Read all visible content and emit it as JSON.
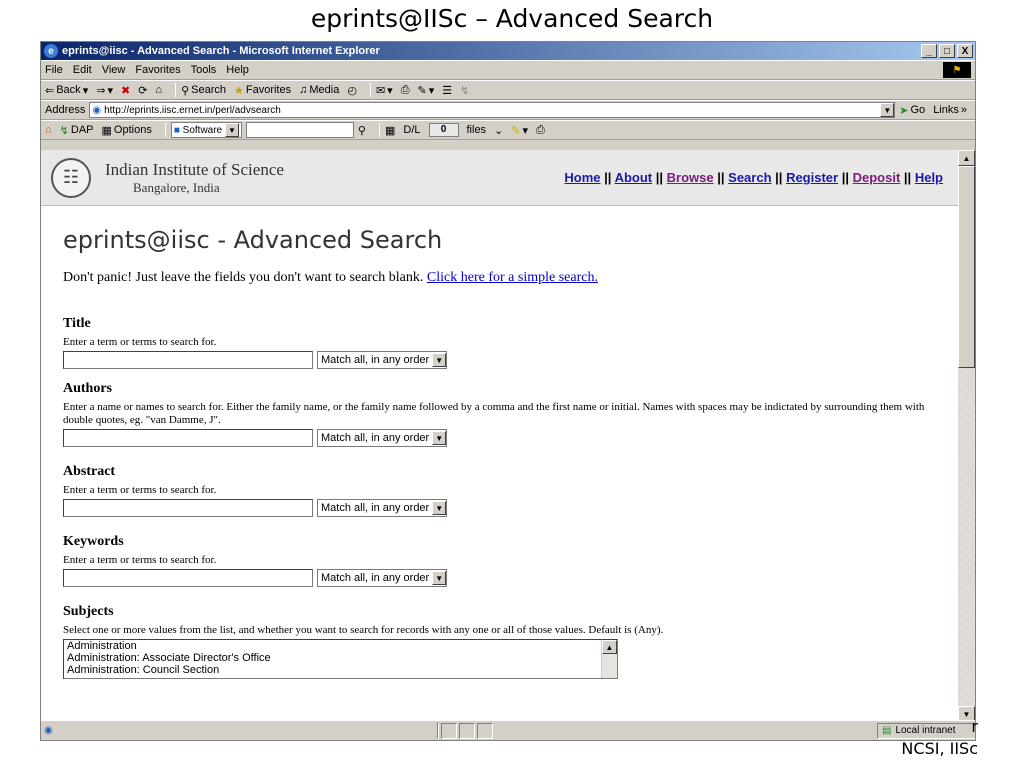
{
  "slide": {
    "title": "eprints@IISc – Advanced Search",
    "footer_lines": [
      "r",
      "NCSI, IISc"
    ]
  },
  "window": {
    "title": "eprints@iisc - Advanced Search - Microsoft Internet Explorer",
    "controls": [
      "_",
      "□",
      "X"
    ]
  },
  "menubar": {
    "items": [
      "File",
      "Edit",
      "View",
      "Favorites",
      "Tools",
      "Help"
    ]
  },
  "toolbar": {
    "back": "Back",
    "search": "Search",
    "favorites": "Favorites",
    "media": "Media"
  },
  "addressbar": {
    "label": "Address",
    "url": "http://eprints.iisc.ernet.in/perl/advsearch",
    "go": "Go",
    "links": "Links"
  },
  "extrabar": {
    "dap": "DAP",
    "options": "Options",
    "software": "Software",
    "dl": "D/L",
    "count": "0",
    "files": "files"
  },
  "site": {
    "institute": "Indian Institute of Science",
    "location": "Bangalore, India",
    "nav": [
      {
        "label": "Home"
      },
      {
        "label": "About"
      },
      {
        "label": "Browse"
      },
      {
        "label": "Search"
      },
      {
        "label": "Register"
      },
      {
        "label": "Deposit"
      },
      {
        "label": "Help"
      }
    ],
    "nav_sep": "||"
  },
  "page": {
    "heading": "eprints@iisc - Advanced Search",
    "intro": "Don't panic! Just leave the fields you don't want to search blank.",
    "simple_link": "Click here for a simple search.",
    "match_default": "Match all, in any order",
    "sections": {
      "title": {
        "heading": "Title",
        "desc": "Enter a term or terms to search for."
      },
      "authors": {
        "heading": "Authors",
        "desc": "Enter a name or names to search for. Either the family name, or the family name followed by a comma and the first name or initial. Names with spaces may be indictated by surrounding them with double quotes, eg. \"van Damme, J\"."
      },
      "abstract": {
        "heading": "Abstract",
        "desc": "Enter a term or terms to search for."
      },
      "keywords": {
        "heading": "Keywords",
        "desc": "Enter a term or terms to search for."
      },
      "subjects": {
        "heading": "Subjects",
        "desc": "Select one or more values from the list, and whether you want to search for records with any one or all of those values. Default is (Any).",
        "options": [
          "Administration",
          "Administration: Associate Director's Office",
          "Administration: Council Section"
        ]
      }
    }
  },
  "statusbar": {
    "zone": "Local intranet"
  }
}
